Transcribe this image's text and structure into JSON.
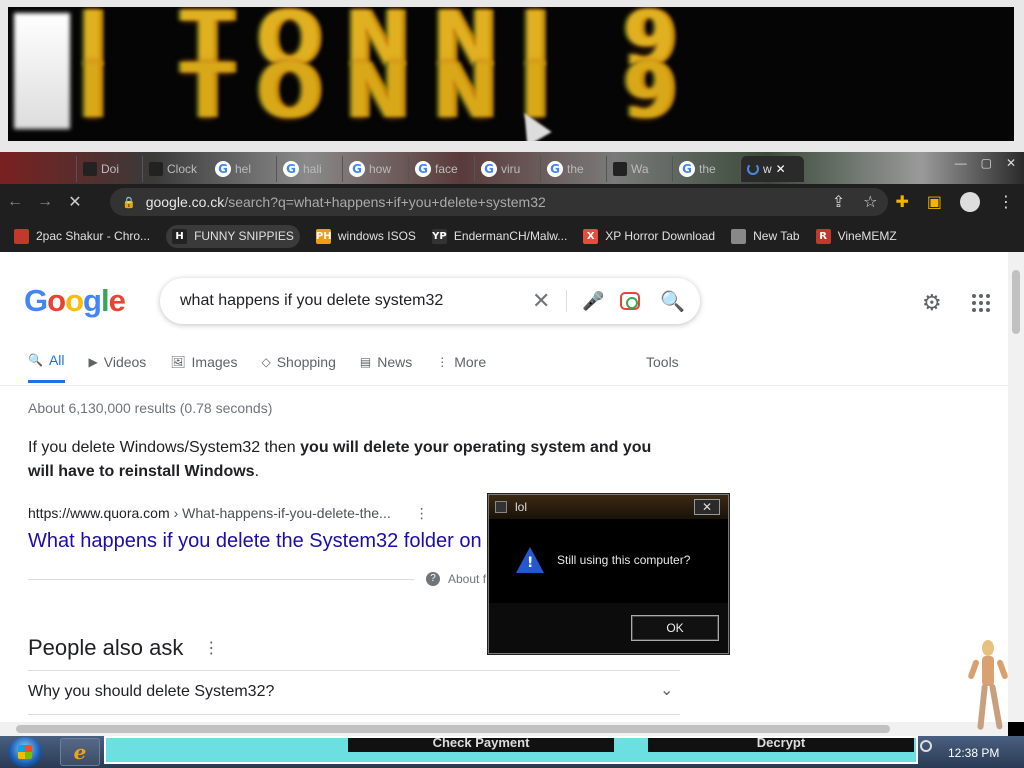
{
  "banner": {
    "glyphs_row1": "I TONNI 9",
    "glyphs_row2": "I TONNI 9"
  },
  "tabs": [
    {
      "label": "Doi",
      "icon": "smiley-icon"
    },
    {
      "label": "Clock",
      "icon": "clock-icon"
    },
    {
      "label": "hel",
      "icon": "google-icon"
    },
    {
      "label": "hali",
      "icon": "google-icon"
    },
    {
      "label": "how",
      "icon": "google-icon"
    },
    {
      "label": "face",
      "icon": "google-icon"
    },
    {
      "label": "viru",
      "icon": "google-icon"
    },
    {
      "label": "the",
      "icon": "google-icon"
    },
    {
      "label": "Wa",
      "icon": "dark-square-icon"
    },
    {
      "label": "the",
      "icon": "google-icon"
    },
    {
      "label": "w",
      "icon": "spinner-icon",
      "active": true
    }
  ],
  "window_controls": {
    "minimize": "—",
    "restore": "▢",
    "close": "✕"
  },
  "address": {
    "domain": "google.co.ck",
    "path": "/search?q=what+happens+if+you+delete+system32"
  },
  "toolbar_icons": [
    "share-icon",
    "star-icon",
    "extension-icon",
    "sidepanel-icon",
    "profile-icon",
    "menu-icon"
  ],
  "bookmarks": [
    {
      "label": "2pac Shakur - Chro...",
      "icon_text": "",
      "color": "#c0392b"
    },
    {
      "label": "FUNNY SNIPPIES",
      "icon_text": "H",
      "color": "#222222"
    },
    {
      "label": "windows ISOS",
      "icon_text": "PH",
      "color": "#f39c12"
    },
    {
      "label": "EndermanCH/Malw...",
      "icon_text": "YP",
      "color": "#333333"
    },
    {
      "label": "XP Horror Download",
      "icon_text": "X",
      "color": "#e74c3c"
    },
    {
      "label": "New Tab",
      "icon_text": "",
      "color": "#888888"
    },
    {
      "label": "VineMEMZ",
      "icon_text": "R",
      "color": "#c0392b"
    }
  ],
  "google": {
    "logo_letters": [
      {
        "ch": "G",
        "color": "#4285f4"
      },
      {
        "ch": "o",
        "color": "#ea4335"
      },
      {
        "ch": "o",
        "color": "#fbbc05"
      },
      {
        "ch": "g",
        "color": "#4285f4"
      },
      {
        "ch": "l",
        "color": "#34a853"
      },
      {
        "ch": "e",
        "color": "#ea4335"
      }
    ],
    "query": "what happens if you delete system32",
    "tabs": [
      {
        "label": "All",
        "icon": "🔍",
        "selected": true
      },
      {
        "label": "Videos",
        "icon": "▶"
      },
      {
        "label": "Images",
        "icon": "🖼"
      },
      {
        "label": "Shopping",
        "icon": "◇"
      },
      {
        "label": "News",
        "icon": "▤"
      },
      {
        "label": "More",
        "icon": "⋮"
      }
    ],
    "tools": "Tools",
    "stats": "About 6,130,000 results (0.78 seconds)",
    "snippet_plain1": "If you delete Windows/System32 then ",
    "snippet_bold": "you will delete your operating system and you will have to reinstall Windows",
    "snippet_plain2": ".",
    "result_url_domain": "https://www.quora.com",
    "result_url_path": "› What-happens-if-you-delete-the...",
    "result_title": "What happens if you delete the System32 folder on W",
    "about_text": "About f",
    "paa_title": "People also ask",
    "paa_question": "Why you should delete System32?"
  },
  "dialog": {
    "title": "lol",
    "message": "Still using this computer?",
    "ok": "OK",
    "close": "✕"
  },
  "taskbar": {
    "ransom_buttons": [
      "Check Payment",
      "Decrypt"
    ],
    "clock": "12:38 PM"
  }
}
